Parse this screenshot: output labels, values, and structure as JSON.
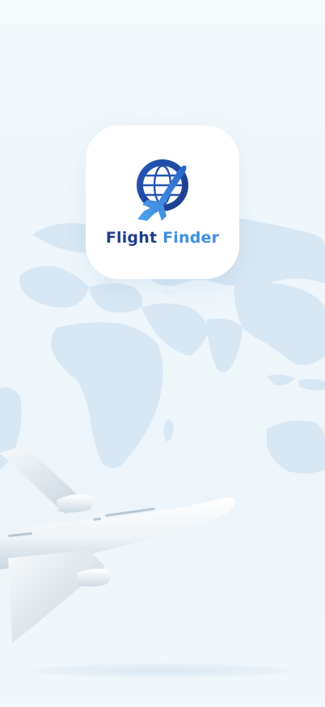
{
  "app": {
    "brand": {
      "word1": "Flight",
      "word2": "Finder"
    }
  },
  "icons": {
    "logo": "airplane-globe-logo-icon",
    "background_map": "world-map-illustration",
    "hero_image": "airliner-illustration"
  },
  "colors": {
    "brand_dark_blue": "#1e3f8a",
    "brand_light_blue": "#3f8fe3",
    "background": "#eef6fb",
    "map_land": "#d7e6f4"
  }
}
